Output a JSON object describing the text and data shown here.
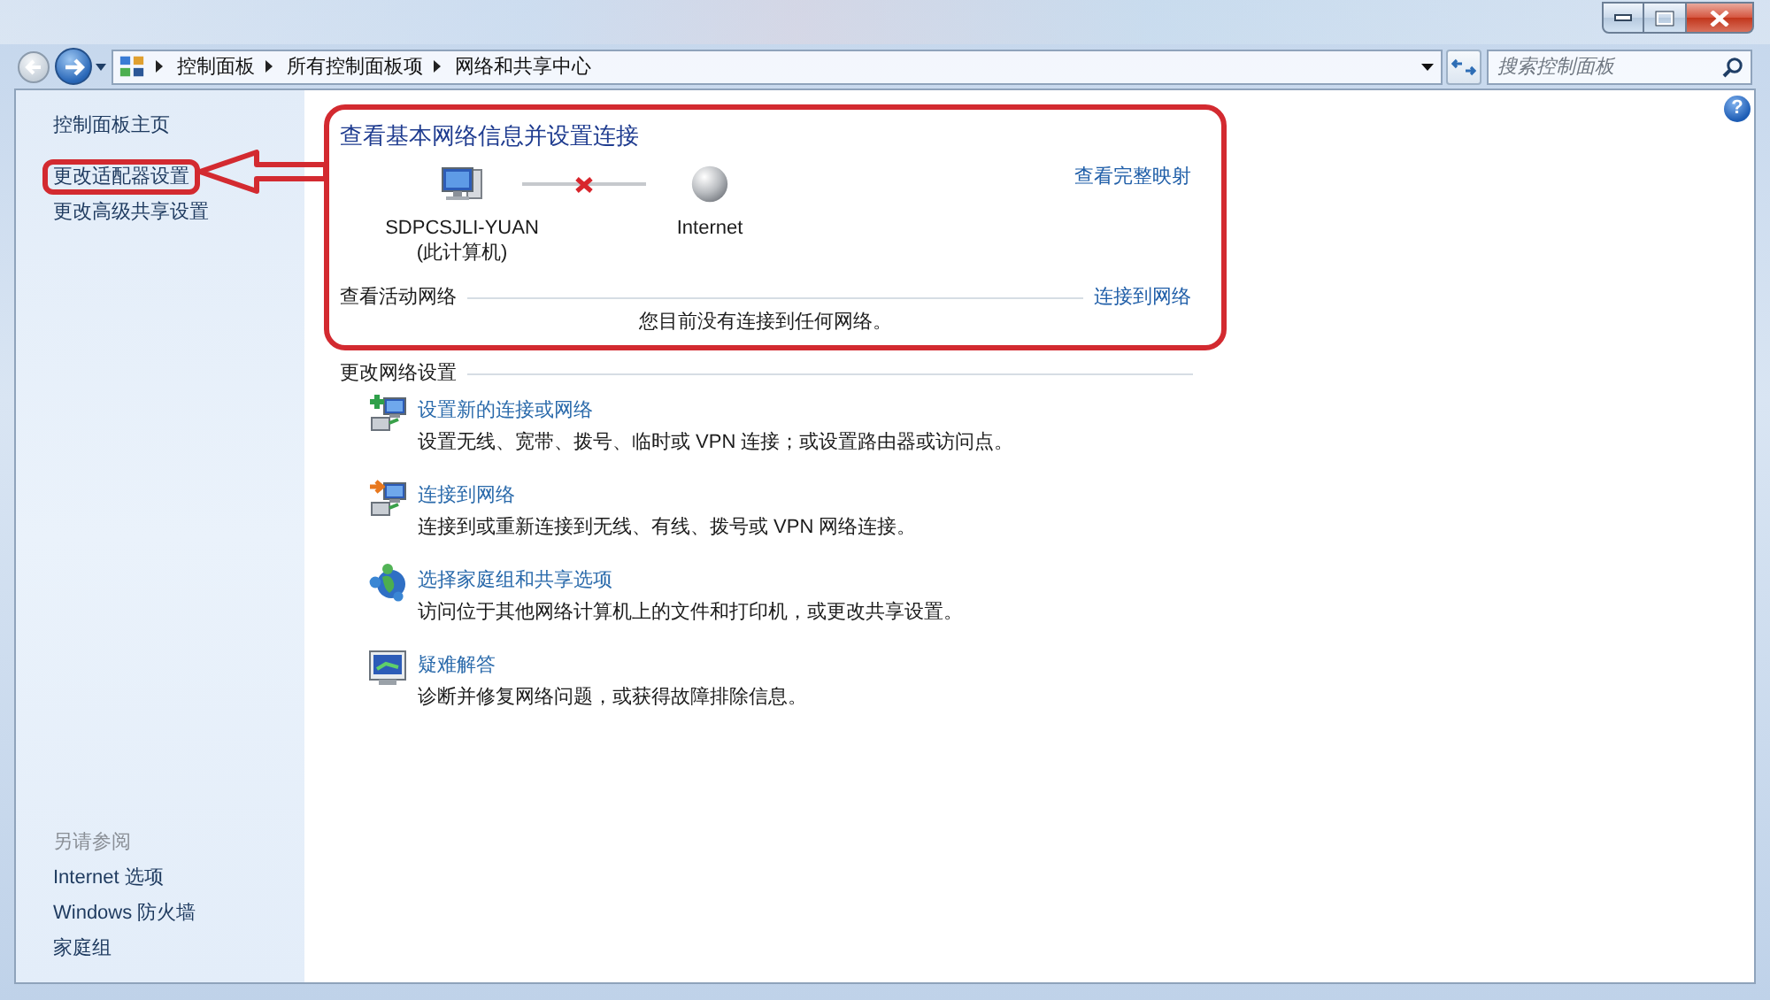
{
  "address_bar": {
    "breadcrumb": [
      "控制面板",
      "所有控制面板项",
      "网络和共享中心"
    ],
    "search": {
      "placeholder": "搜索控制面板"
    }
  },
  "help": {
    "glyph": "?"
  },
  "sidebar": {
    "links": [
      {
        "label": "控制面板主页",
        "highlighted": false
      },
      {
        "label": "更改适配器设置",
        "highlighted": true
      },
      {
        "label": "更改高级共享设置",
        "highlighted": false
      }
    ],
    "see_also": {
      "heading": "另请参阅",
      "links": [
        "Internet 选项",
        "Windows 防火墙",
        "家庭组"
      ]
    }
  },
  "network_info": {
    "highlighted": true,
    "title": "查看基本网络信息并设置连接",
    "map_link": "查看完整映射",
    "nodes": [
      {
        "kind": "computer",
        "name": "SDPCSJLI-YUAN",
        "note": "(此计算机)"
      },
      {
        "kind": "internet",
        "name": "Internet"
      }
    ],
    "connected": false,
    "active_networks": {
      "heading": "查看活动网络",
      "link": "连接到网络",
      "message": "您目前没有连接到任何网络。"
    }
  },
  "change_settings": {
    "heading": "更改网络设置",
    "tasks": [
      {
        "kind": "new_connection",
        "title": "设置新的连接或网络",
        "description": "设置无线、宽带、拨号、临时或 VPN 连接；或设置路由器或访问点。"
      },
      {
        "kind": "connect",
        "title": "连接到网络",
        "description": "连接到或重新连接到无线、有线、拨号或 VPN 网络连接。"
      },
      {
        "kind": "homegroup",
        "title": "选择家庭组和共享选项",
        "description": "访问位于其他网络计算机上的文件和打印机，或更改共享设置。"
      },
      {
        "kind": "troubleshoot",
        "title": "疑难解答",
        "description": "诊断并修复网络问题，或获得故障排除信息。"
      }
    ]
  }
}
